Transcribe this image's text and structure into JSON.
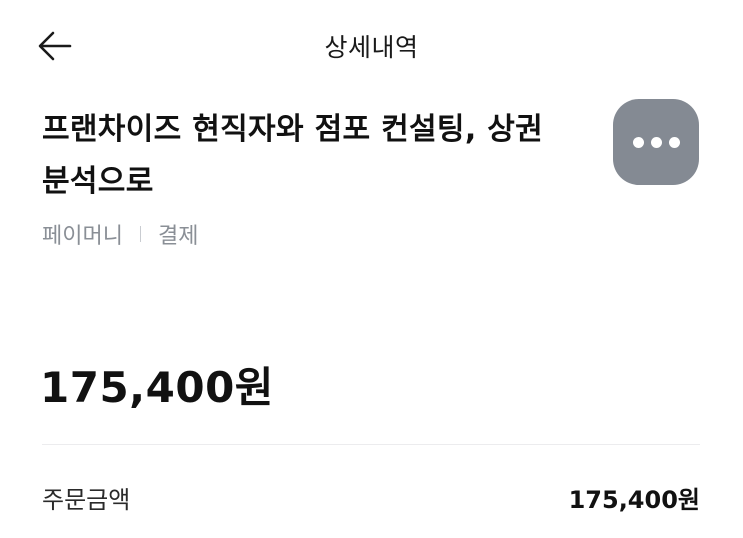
{
  "header": {
    "back_icon": "arrow-left-icon",
    "title": "상세내역"
  },
  "transaction": {
    "merchant_line1": "프랜차이즈 현직자와 점포 컨설팅, 상권",
    "merchant_line2": "분석으로",
    "more_icon": "more-horizontal-icon",
    "payment_method": "페이머니",
    "payment_type": "결제",
    "amount": "175,400원"
  },
  "details": {
    "order_amount_label": "주문금액",
    "order_amount_value": "175,400원"
  },
  "colors": {
    "more_button_bg": "#848a93",
    "meta_text": "#8a8f96",
    "divider": "#ececee"
  }
}
